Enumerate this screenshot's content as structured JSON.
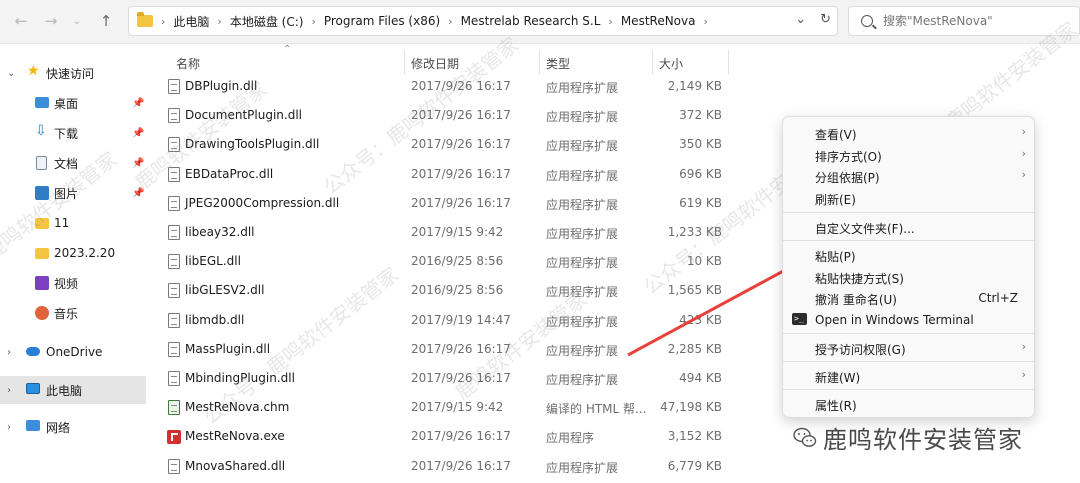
{
  "address": {
    "crumbs": [
      "此电脑",
      "本地磁盘 (C:)",
      "Program Files (x86)",
      "Mestrelab Research S.L",
      "MestReNova"
    ]
  },
  "search": {
    "placeholder": "搜索\"MestReNova\""
  },
  "sidebar": {
    "items": [
      {
        "label": "快速访问",
        "icon": "star-icon"
      },
      {
        "label": "桌面",
        "icon": "desktop-icon"
      },
      {
        "label": "下载",
        "icon": "download-icon"
      },
      {
        "label": "文档",
        "icon": "document-icon"
      },
      {
        "label": "图片",
        "icon": "picture-icon"
      },
      {
        "label": "11",
        "icon": "folder-icon"
      },
      {
        "label": "2023.2.20",
        "icon": "folder-icon"
      },
      {
        "label": "视频",
        "icon": "video-icon"
      },
      {
        "label": "音乐",
        "icon": "music-icon"
      },
      {
        "label": "OneDrive",
        "icon": "cloud-icon"
      },
      {
        "label": "此电脑",
        "icon": "computer-icon"
      },
      {
        "label": "网络",
        "icon": "network-icon"
      }
    ]
  },
  "columns": {
    "name": "名称",
    "date": "修改日期",
    "type": "类型",
    "size": "大小"
  },
  "files": [
    {
      "name": "DBPlugin.dll",
      "date": "2017/9/26 16:17",
      "type": "应用程序扩展",
      "size": "2,149 KB",
      "kind": "dll"
    },
    {
      "name": "DocumentPlugin.dll",
      "date": "2017/9/26 16:17",
      "type": "应用程序扩展",
      "size": "372 KB",
      "kind": "dll"
    },
    {
      "name": "DrawingToolsPlugin.dll",
      "date": "2017/9/26 16:17",
      "type": "应用程序扩展",
      "size": "350 KB",
      "kind": "dll"
    },
    {
      "name": "EBDataProc.dll",
      "date": "2017/9/26 16:17",
      "type": "应用程序扩展",
      "size": "696 KB",
      "kind": "dll"
    },
    {
      "name": "JPEG2000Compression.dll",
      "date": "2017/9/26 16:17",
      "type": "应用程序扩展",
      "size": "619 KB",
      "kind": "dll"
    },
    {
      "name": "libeay32.dll",
      "date": "2017/9/15 9:42",
      "type": "应用程序扩展",
      "size": "1,233 KB",
      "kind": "dll"
    },
    {
      "name": "libEGL.dll",
      "date": "2016/9/25 8:56",
      "type": "应用程序扩展",
      "size": "10 KB",
      "kind": "dll"
    },
    {
      "name": "libGLESV2.dll",
      "date": "2016/9/25 8:56",
      "type": "应用程序扩展",
      "size": "1,565 KB",
      "kind": "dll"
    },
    {
      "name": "libmdb.dll",
      "date": "2017/9/19 14:47",
      "type": "应用程序扩展",
      "size": "423 KB",
      "kind": "dll"
    },
    {
      "name": "MassPlugin.dll",
      "date": "2017/9/26 16:17",
      "type": "应用程序扩展",
      "size": "2,285 KB",
      "kind": "dll"
    },
    {
      "name": "MbindingPlugin.dll",
      "date": "2017/9/26 16:17",
      "type": "应用程序扩展",
      "size": "494 KB",
      "kind": "dll"
    },
    {
      "name": "MestReNova.chm",
      "date": "2017/9/15 9:42",
      "type": "编译的 HTML 帮...",
      "size": "47,198 KB",
      "kind": "chm"
    },
    {
      "name": "MestReNova.exe",
      "date": "2017/9/26 16:17",
      "type": "应用程序",
      "size": "3,152 KB",
      "kind": "exe"
    },
    {
      "name": "MnovaShared.dll",
      "date": "2017/9/26 16:17",
      "type": "应用程序扩展",
      "size": "6,779 KB",
      "kind": "dll"
    }
  ],
  "context_menu": {
    "items": [
      {
        "label": "查看(V)",
        "submenu": true
      },
      {
        "label": "排序方式(O)",
        "submenu": true
      },
      {
        "label": "分组依据(P)",
        "submenu": true
      },
      {
        "label": "刷新(E)"
      },
      {
        "label": "自定义文件夹(F)..."
      },
      {
        "label": "粘贴(P)"
      },
      {
        "label": "粘贴快捷方式(S)"
      },
      {
        "label": "撤消 重命名(U)",
        "shortcut": "Ctrl+Z"
      },
      {
        "label": "Open in Windows Terminal",
        "icon": "terminal-icon"
      },
      {
        "label": "授予访问权限(G)",
        "submenu": true
      },
      {
        "label": "新建(W)",
        "submenu": true
      },
      {
        "label": "属性(R)"
      }
    ]
  },
  "watermark": {
    "brand": "鹿鸣软件安装管家",
    "repeat": "公众号：鹿鸣软件安装管家"
  },
  "colors": {
    "arrow": "#e8403a",
    "selection": "#e5e5e5",
    "folder": "#f5c542"
  }
}
